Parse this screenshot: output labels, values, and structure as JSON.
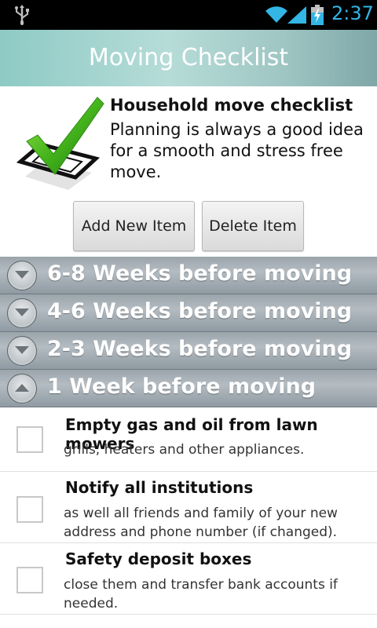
{
  "status_bar": {
    "time": "2:37",
    "icons": [
      "usb-icon",
      "wifi-icon",
      "signal-icon",
      "battery-charging-icon"
    ],
    "accent_color": "#33b5e5"
  },
  "app": {
    "title": "Moving Checklist"
  },
  "header": {
    "title": "Household move checklist",
    "description": "Planning is always a good idea for a smooth and stress free move.",
    "icon": "checkmark-box-icon"
  },
  "buttons": {
    "add_label": "Add New Item",
    "delete_label": "Delete Item"
  },
  "groups": [
    {
      "label": "6-8 Weeks before moving",
      "expanded": false
    },
    {
      "label": "4-6 Weeks before moving",
      "expanded": false
    },
    {
      "label": "2-3 Weeks before moving",
      "expanded": false
    },
    {
      "label": "1 Week before moving",
      "expanded": true
    }
  ],
  "items": [
    {
      "title": "Empty gas and oil from lawn mowers",
      "description": "grills, heaters and other appliances.",
      "checked": false
    },
    {
      "title": "Notify all institutions",
      "description": "as well all friends and family of your new address and phone number (if changed).",
      "checked": false
    },
    {
      "title": "Safety deposit boxes",
      "description": "close them and transfer bank accounts if needed.",
      "checked": false
    }
  ]
}
